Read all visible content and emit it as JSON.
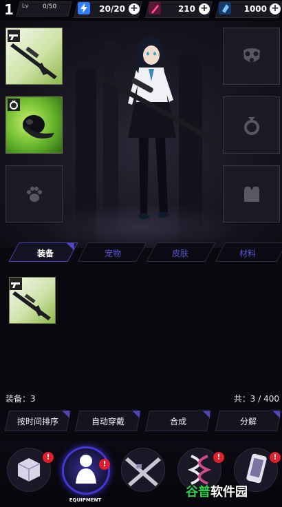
{
  "player": {
    "level": "1",
    "lv_label": "Lv",
    "exp": "0/50"
  },
  "resources": {
    "energy": {
      "icon": "lightning-icon",
      "value": "20/20",
      "color": "#2f7fff"
    },
    "ammo": {
      "icon": "bullet-icon",
      "value": "210",
      "color": "#c0276f"
    },
    "crystal": {
      "icon": "crystal-icon",
      "value": "1000",
      "color": "#5ea6ff"
    }
  },
  "equipment_slots": {
    "left": [
      {
        "name": "weapon-slot",
        "icon": "gun-icon",
        "filled": true
      },
      {
        "name": "accessory-slot",
        "icon": "ring-icon",
        "filled": true
      },
      {
        "name": "pet-slot",
        "icon": "paw-icon",
        "filled": false
      }
    ],
    "right": [
      {
        "name": "mask-slot",
        "icon": "gas-mask-icon",
        "filled": false
      },
      {
        "name": "ring-slot",
        "icon": "ring-icon",
        "filled": false
      },
      {
        "name": "clothing-slot",
        "icon": "shirt-icon",
        "filled": false
      }
    ]
  },
  "tabs": [
    {
      "label": "装备",
      "active": true
    },
    {
      "label": "宠物",
      "active": false
    },
    {
      "label": "皮肤",
      "active": false
    },
    {
      "label": "材料",
      "active": false
    }
  ],
  "inventory": {
    "items": [
      {
        "icon": "sniper-rifle-icon"
      }
    ],
    "equip_count": "装备：3",
    "total_count": "共：3 / 400"
  },
  "actions": [
    {
      "label": "按时间排序"
    },
    {
      "label": "自动穿戴"
    },
    {
      "label": "合成"
    },
    {
      "label": "分解"
    }
  ],
  "bottom_nav": [
    {
      "name": "cube",
      "icon": "cube-icon",
      "badge": "!"
    },
    {
      "name": "equipment",
      "icon": "character-icon",
      "badge": "!",
      "caption": "EQUIPMENT",
      "active": true
    },
    {
      "name": "weapons",
      "icon": "crossed-guns-icon"
    },
    {
      "name": "genes",
      "icon": "dna-icon",
      "badge": "!"
    },
    {
      "name": "phone",
      "icon": "phone-icon",
      "badge": "!"
    }
  ],
  "watermark": {
    "part1": "谷普",
    "part2": "软件园"
  },
  "colors": {
    "accent": "#4e46b8",
    "tab_inactive": "#5b54d6",
    "badge": "#e21f2b",
    "item_green": "#8db84a"
  }
}
